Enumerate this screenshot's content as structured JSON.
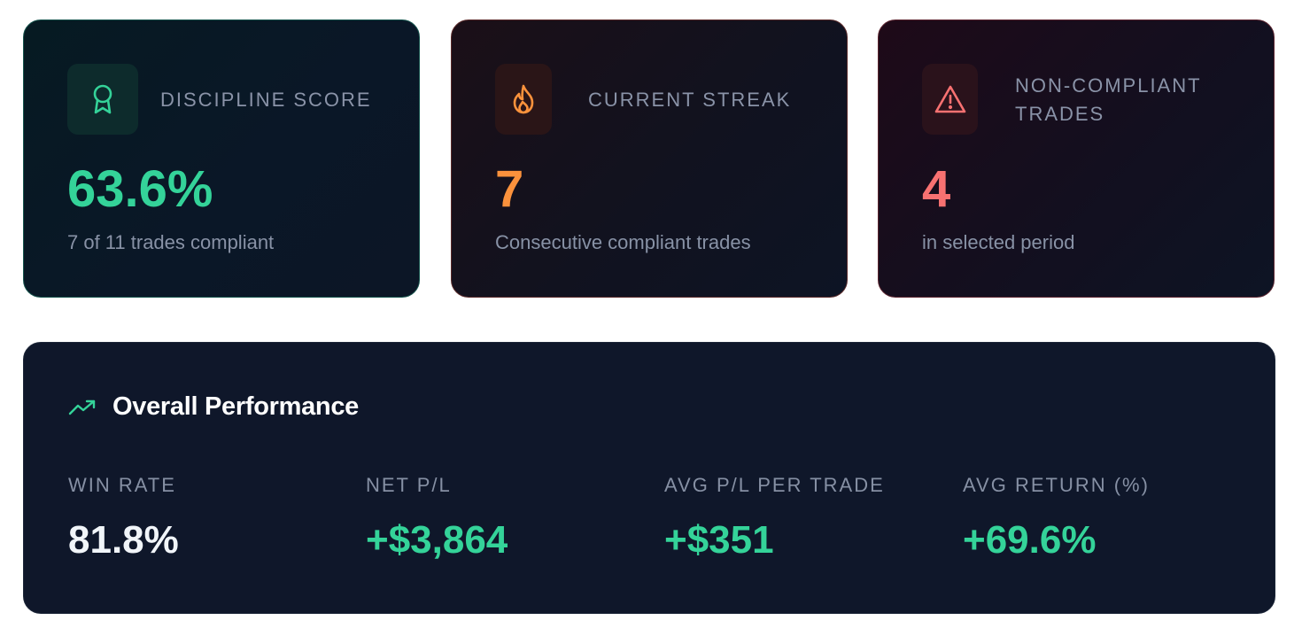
{
  "colors": {
    "green": "#34d399",
    "orange": "#fb923c",
    "red": "#f87171",
    "white": "#f1f5f9",
    "muted": "#8a93a8",
    "panel_bg": "#0f172a"
  },
  "cards": [
    {
      "label": "DISCIPLINE SCORE",
      "icon": "award-ribbon-icon",
      "value": "63.6%",
      "subtitle": "7 of 11 trades compliant",
      "accent": "#34d399"
    },
    {
      "label": "CURRENT STREAK",
      "icon": "flame-icon",
      "value": "7",
      "subtitle": "Consecutive compliant trades",
      "accent": "#fb923c"
    },
    {
      "label": "NON-COMPLIANT TRADES",
      "icon": "warning-triangle-icon",
      "value": "4",
      "subtitle": "in selected period",
      "accent": "#f87171"
    }
  ],
  "performance": {
    "title": "Overall Performance",
    "icon": "trending-up-icon",
    "metrics": [
      {
        "label": "WIN RATE",
        "value": "81.8%",
        "color": "#f1f5f9"
      },
      {
        "label": "NET P/L",
        "value": "+$3,864",
        "color": "#34d399"
      },
      {
        "label": "AVG P/L PER TRADE",
        "value": "+$351",
        "color": "#34d399"
      },
      {
        "label": "AVG RETURN (%)",
        "value": "+69.6%",
        "color": "#34d399"
      }
    ]
  }
}
